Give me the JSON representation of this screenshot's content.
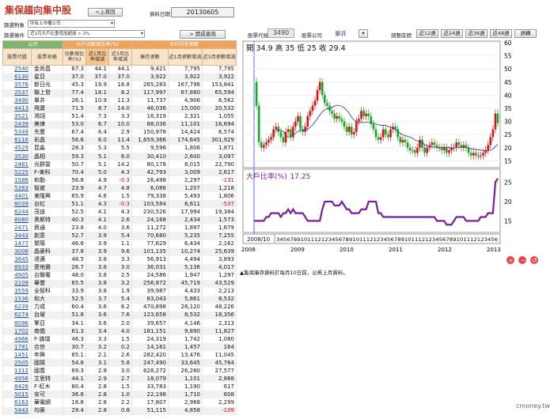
{
  "header": {
    "title": "集保趨向集中股",
    "prev_button": "<上頁回",
    "date_label": "資料日期",
    "date_value": "20130605"
  },
  "filters": {
    "target_label": "篩選對象",
    "target_value": "所有上市櫃公司",
    "cond_label": "篩選條件",
    "cond_value": "近1月大戶比重增加超過 > 2%",
    "query_button": "> 開成查詢"
  },
  "stock_bar": {
    "code_label": "股票代號",
    "code_value": "3490",
    "company_label": "股票公司",
    "company_value": "單井",
    "period_label": "調整區間",
    "periods": [
      "近12週",
      "近24週",
      "近36週",
      "近48週",
      "週轉"
    ]
  },
  "table": {
    "group_company": "公司",
    "group_ratio": "大戶佔集保比率(%)",
    "group_holding": "大戶持有張數",
    "columns": [
      "股票代號",
      "股票名稱",
      "佔集保比率(%)",
      "近1月比率增減",
      "近3月比率增減",
      "庫存張數",
      "近1月張數增減",
      "近3月張數增減"
    ],
    "rows": [
      [
        "2540",
        "金尚昌",
        "67.3",
        "44.1",
        "44.1",
        "9,421",
        "7,795",
        "7,795"
      ],
      [
        "6130",
        "星亞",
        "37.0",
        "37.0",
        "37.0",
        "3,922",
        "3,922",
        "3,922"
      ],
      [
        "3576",
        "新日光",
        "45.3",
        "19.9",
        "16.8",
        "265,283",
        "167,796",
        "153,841"
      ],
      [
        "2537",
        "聯上發",
        "77.4",
        "18.1",
        "8.2",
        "117,997",
        "67,880",
        "65,594"
      ],
      [
        "3490",
        "單井",
        "26.1",
        "10.9",
        "11.3",
        "11,737",
        "4,906",
        "6,562"
      ],
      [
        "4413",
        "飛寶",
        "71.5",
        "8.7",
        "14.0",
        "46,036",
        "15,000",
        "20,532"
      ],
      [
        "3521",
        "鴻翊",
        "51.4",
        "7.3",
        "3.3",
        "16,319",
        "2,321",
        "1,055"
      ],
      [
        "2439",
        "美律",
        "53.0",
        "6.7",
        "10.0",
        "88,036",
        "11,101",
        "16,694"
      ],
      [
        "5349",
        "先豐",
        "67.4",
        "6.4",
        "2.9",
        "150,978",
        "14,424",
        "6,574"
      ],
      [
        "6116",
        "彩晶",
        "56.6",
        "6.0",
        "11.4",
        "1,659,366",
        "174,645",
        "301,929"
      ],
      [
        "4529",
        "昆淼",
        "28.3",
        "5.3",
        "5.5",
        "9,596",
        "1,806",
        "1,871"
      ],
      [
        "3530",
        "晶相",
        "59.3",
        "5.1",
        "6.0",
        "30,410",
        "2,600",
        "3,097"
      ],
      [
        "2461",
        "光群雷",
        "50.7",
        "5.1",
        "14.2",
        "80,178",
        "8,015",
        "22,790"
      ],
      [
        "5225",
        "F-東科",
        "70.4",
        "5.0",
        "4.3",
        "42,793",
        "3,009",
        "2,617"
      ],
      [
        "1586",
        "和勤",
        "56.8",
        "4.9",
        "-0.3",
        "26,498",
        "2,297",
        "-131"
      ],
      [
        "5263",
        "智崴",
        "23.9",
        "4.7",
        "4.8",
        "6,086",
        "1,207",
        "1,218"
      ],
      [
        "4401",
        "東隆興",
        "65.9",
        "4.6",
        "1.5",
        "79,338",
        "5,493",
        "1,806"
      ],
      [
        "8039",
        "台虹",
        "51.1",
        "4.3",
        "-0.3",
        "103,584",
        "8,611",
        "-537"
      ],
      [
        "6244",
        "茂迪",
        "52.5",
        "4.1",
        "4.3",
        "230,526",
        "17,994",
        "19,384"
      ],
      [
        "8080",
        "奧斯特",
        "40.3",
        "4.1",
        "2.6",
        "24,168",
        "2,434",
        "1,573"
      ],
      [
        "2471",
        "資通",
        "23.8",
        "4.0",
        "3.6",
        "11,272",
        "1,897",
        "1,679"
      ],
      [
        "3443",
        "創意",
        "52.7",
        "3.9",
        "5.4",
        "70,680",
        "5,235",
        "7,255"
      ],
      [
        "1477",
        "聚陽",
        "46.6",
        "3.9",
        "1.1",
        "77,629",
        "6,434",
        "2,162"
      ],
      [
        "3006",
        "晶豪科",
        "37.8",
        "3.9",
        "9.6",
        "101,135",
        "10,274",
        "25,639"
      ],
      [
        "3645",
        "達邁",
        "48.5",
        "3.8",
        "3.3",
        "56,913",
        "4,494",
        "3,893"
      ],
      [
        "8933",
        "愛地雅",
        "26.7",
        "3.8",
        "3.0",
        "36,031",
        "5,136",
        "4,017"
      ],
      [
        "4905",
        "台聯電",
        "48.0",
        "3.8",
        "2.5",
        "24,586",
        "1,947",
        "1,297"
      ],
      [
        "2109",
        "華豐",
        "65.5",
        "3.8",
        "3.2",
        "256,872",
        "45,719",
        "43,529"
      ],
      [
        "3559",
        "全智科",
        "33.9",
        "3.8",
        "1.9",
        "39,987",
        "4,433",
        "2,213"
      ],
      [
        "1536",
        "和大",
        "52.5",
        "3.7",
        "5.4",
        "83,043",
        "5,861",
        "8,532"
      ],
      [
        "6239",
        "力成",
        "60.4",
        "3.6",
        "6.2",
        "470,898",
        "28,120",
        "48,226"
      ],
      [
        "6274",
        "台燿",
        "51.8",
        "3.6",
        "7.6",
        "123,658",
        "8,532",
        "18,356"
      ],
      [
        "8096",
        "擎亞",
        "34.1",
        "3.6",
        "2.0",
        "39,657",
        "4,146",
        "2,313"
      ],
      [
        "1702",
        "南僑",
        "61.3",
        "3.4",
        "4.0",
        "181,151",
        "9,890",
        "11,827"
      ],
      [
        "4966",
        "F-譜瑞",
        "46.3",
        "3.3",
        "1.5",
        "24,319",
        "1,742",
        "1,080"
      ],
      [
        "1781",
        "合世",
        "30.7",
        "3.2",
        "0.2",
        "14,161",
        "1,457",
        "164"
      ],
      [
        "1451",
        "年興",
        "65.1",
        "2.1",
        "2.6",
        "282,420",
        "13,476",
        "11,045"
      ],
      [
        "2505",
        "國揚",
        "54.8",
        "3.1",
        "5.8",
        "247,490",
        "33,645",
        "45,764"
      ],
      [
        "1312",
        "國喬",
        "69.3",
        "2.9",
        "3.0",
        "628,272",
        "26,280",
        "27,577"
      ],
      [
        "4956",
        "艾思特",
        "44.1",
        "2.9",
        "2.7",
        "18,079",
        "1,101",
        "2,868"
      ],
      [
        "8426",
        "F-紅木",
        "80.4",
        "2.8",
        "1.5",
        "33,783",
        "1,190",
        "617"
      ],
      [
        "5015",
        "安可",
        "36.6",
        "2.8",
        "1.0",
        "22,198",
        "1,710",
        "608"
      ],
      [
        "6163",
        "華電網",
        "16.8",
        "2.8",
        "2.2",
        "17,807",
        "2,968",
        "2,299"
      ],
      [
        "5443",
        "均豪",
        "29.4",
        "2.8",
        "0.8",
        "51,115",
        "4,858",
        "-109"
      ]
    ]
  },
  "chart": {
    "ohlc_text": "開 34.9  高 35  低 25  收 29.4",
    "ratio_label": "大戶比率(%)",
    "ratio_value": "17.25",
    "cursor_date": "2008/10",
    "price_axis": [
      "60",
      "55",
      "50",
      "45",
      "40",
      "35",
      "30",
      "25",
      "20",
      "15"
    ],
    "ratio_axis": [
      "25",
      "20",
      "15"
    ],
    "x_month_labels": "3456789101112123456789101112123456789101112123456789101112123456",
    "year_labels": [
      "2008",
      "2009",
      "2010",
      "2011",
      "2012",
      "2013"
    ],
    "note": "▲集保庫存資料於每月10日前，公佈上月資料。",
    "brand": "cmoney.tw"
  },
  "chart_data": {
    "type": "line",
    "title": "",
    "series": [
      {
        "name": "大戶比率(%)",
        "values": [
          15,
          15,
          15,
          15,
          15,
          16,
          16,
          17,
          17,
          17,
          17,
          16,
          17,
          17,
          18,
          17,
          18,
          17,
          17,
          17,
          17,
          16,
          15,
          15,
          15,
          15,
          15,
          15,
          18,
          20,
          20,
          20,
          20,
          19,
          19,
          19,
          20,
          19,
          18,
          18,
          17,
          17,
          17,
          17,
          18,
          18,
          18,
          20,
          20,
          20,
          20,
          17,
          17,
          16,
          16,
          16,
          16,
          16,
          16,
          16,
          16,
          16,
          16,
          16,
          16,
          16,
          16,
          16,
          16,
          16,
          16,
          16,
          16,
          16,
          16,
          15,
          15,
          15,
          15,
          14,
          14,
          14,
          15,
          16,
          16,
          16,
          16,
          15,
          15,
          15,
          15,
          15,
          15,
          16,
          16,
          16,
          17,
          17,
          17,
          25,
          26
        ]
      },
      {
        "name": "price_close",
        "values": [
          45,
          36,
          22,
          20,
          21,
          22,
          23,
          24,
          27,
          28,
          26,
          24,
          22,
          26,
          27,
          24,
          28,
          30,
          32,
          27,
          26,
          28,
          32,
          34,
          36,
          38,
          42,
          45,
          40,
          37,
          36,
          34,
          33,
          31,
          32,
          31,
          30,
          28,
          26,
          28,
          25,
          26,
          30,
          31,
          34,
          32,
          33,
          32,
          29,
          27,
          24,
          23,
          24,
          27,
          25,
          24,
          27,
          28,
          27,
          24,
          22,
          23,
          22,
          20,
          19,
          19,
          18,
          20,
          23,
          20,
          18,
          20,
          21,
          22,
          21,
          20,
          20,
          19,
          20,
          18,
          19,
          20,
          20,
          22,
          21,
          20,
          21,
          20,
          18,
          17,
          18,
          17,
          17,
          17,
          18,
          19,
          21,
          24,
          27,
          33,
          29.4
        ]
      }
    ],
    "price_ylim": [
      13,
      60
    ],
    "ratio_ylim": [
      12,
      28
    ]
  }
}
